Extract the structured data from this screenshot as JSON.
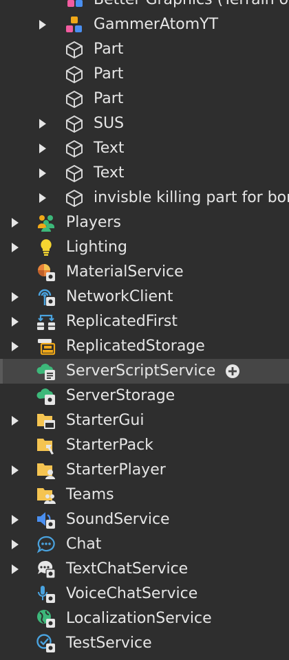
{
  "explorer": {
    "rows": [
      {
        "label": "Better Graphics  (Terrain of",
        "icon": "model-icon",
        "depth": 1,
        "expandable": false
      },
      {
        "label": "GammerAtomYT",
        "icon": "model-icon",
        "depth": 1,
        "expandable": true
      },
      {
        "label": "Part",
        "icon": "part-icon",
        "depth": 1,
        "expandable": false
      },
      {
        "label": "Part",
        "icon": "part-icon",
        "depth": 1,
        "expandable": false
      },
      {
        "label": "Part",
        "icon": "part-icon",
        "depth": 1,
        "expandable": false
      },
      {
        "label": "SUS",
        "icon": "part-icon",
        "depth": 1,
        "expandable": true
      },
      {
        "label": "Text",
        "icon": "part-icon",
        "depth": 1,
        "expandable": true
      },
      {
        "label": "Text",
        "icon": "part-icon",
        "depth": 1,
        "expandable": true
      },
      {
        "label": "invisble killing part for bor",
        "icon": "part-icon",
        "depth": 1,
        "expandable": true
      },
      {
        "label": "Players",
        "icon": "players-icon",
        "depth": 0,
        "expandable": true
      },
      {
        "label": "Lighting",
        "icon": "lightbulb-icon",
        "depth": 0,
        "expandable": true
      },
      {
        "label": "MaterialService",
        "icon": "material-service-icon",
        "depth": 0,
        "expandable": false
      },
      {
        "label": "NetworkClient",
        "icon": "network-client-icon",
        "depth": 0,
        "expandable": true
      },
      {
        "label": "ReplicatedFirst",
        "icon": "replicated-first-icon",
        "depth": 0,
        "expandable": true
      },
      {
        "label": "ReplicatedStorage",
        "icon": "replicated-storage-icon",
        "depth": 0,
        "expandable": true
      },
      {
        "label": "ServerScriptService",
        "icon": "server-script-service-icon",
        "depth": 0,
        "expandable": false,
        "selected": true
      },
      {
        "label": "ServerStorage",
        "icon": "server-storage-icon",
        "depth": 0,
        "expandable": false
      },
      {
        "label": "StarterGui",
        "icon": "starter-gui-icon",
        "depth": 0,
        "expandable": true
      },
      {
        "label": "StarterPack",
        "icon": "starter-pack-icon",
        "depth": 0,
        "expandable": false
      },
      {
        "label": "StarterPlayer",
        "icon": "starter-player-icon",
        "depth": 0,
        "expandable": true
      },
      {
        "label": "Teams",
        "icon": "teams-icon",
        "depth": 0,
        "expandable": false
      },
      {
        "label": "SoundService",
        "icon": "sound-service-icon",
        "depth": 0,
        "expandable": true
      },
      {
        "label": "Chat",
        "icon": "chat-icon",
        "depth": 0,
        "expandable": true
      },
      {
        "label": "TextChatService",
        "icon": "text-chat-service-icon",
        "depth": 0,
        "expandable": true
      },
      {
        "label": "VoiceChatService",
        "icon": "voice-chat-service-icon",
        "depth": 0,
        "expandable": false
      },
      {
        "label": "LocalizationService",
        "icon": "localization-service-icon",
        "depth": 0,
        "expandable": false
      },
      {
        "label": "TestService",
        "icon": "test-service-icon",
        "depth": 0,
        "expandable": false
      }
    ],
    "add_button_icon": "plus-circle-icon"
  },
  "colors": {
    "background": "#2e2e2e",
    "selected_row": "#464646",
    "text": "#e6e6e6",
    "folder": "#f5c451",
    "green": "#3db87a",
    "blue": "#4aa3df",
    "orange": "#e8833a"
  }
}
